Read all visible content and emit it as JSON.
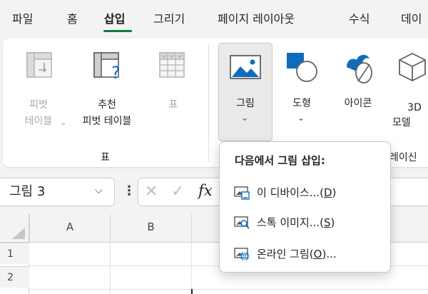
{
  "menu": {
    "tabs": [
      {
        "label": "파일"
      },
      {
        "label": "홈"
      },
      {
        "label": "삽입"
      },
      {
        "label": "그리기"
      },
      {
        "label": "페이지 레이아웃"
      },
      {
        "label": "수식"
      },
      {
        "label": "데이"
      }
    ],
    "active_tab": "삽입"
  },
  "ribbon": {
    "pivot": {
      "line1": "피벗",
      "line2": "테이블"
    },
    "recommended": {
      "line1": "추천",
      "line2": "피벗 테이블"
    },
    "table": {
      "label": "표"
    },
    "group_tables": "표",
    "picture": {
      "label": "그림"
    },
    "shapes": {
      "label": "도형"
    },
    "icons": {
      "label": "아이콘"
    },
    "models3d": {
      "line1": "3D",
      "line2": "모델"
    },
    "group_illustrations_partial": "레이신"
  },
  "formula_bar": {
    "name_box": "그림 3",
    "fx": "fx"
  },
  "grid": {
    "columns": [
      "A",
      "B"
    ],
    "rows": [
      "1",
      "2"
    ]
  },
  "dropdown": {
    "title": "다음에서 그림 삽입:",
    "items": [
      {
        "label": "이 디바이스...",
        "key": "D",
        "icon": "device-image-icon"
      },
      {
        "label": "스톡 이미지...",
        "key": "S",
        "icon": "stock-image-icon"
      },
      {
        "label": "온라인 그림",
        "key": "O",
        "suffix": "...",
        "icon": "online-image-icon"
      }
    ]
  },
  "colors": {
    "accent": "#107c41",
    "icon_blue": "#0f6cbd",
    "ribbon_bg": "#ffffff",
    "chrome_bg": "#f3f3f3"
  }
}
